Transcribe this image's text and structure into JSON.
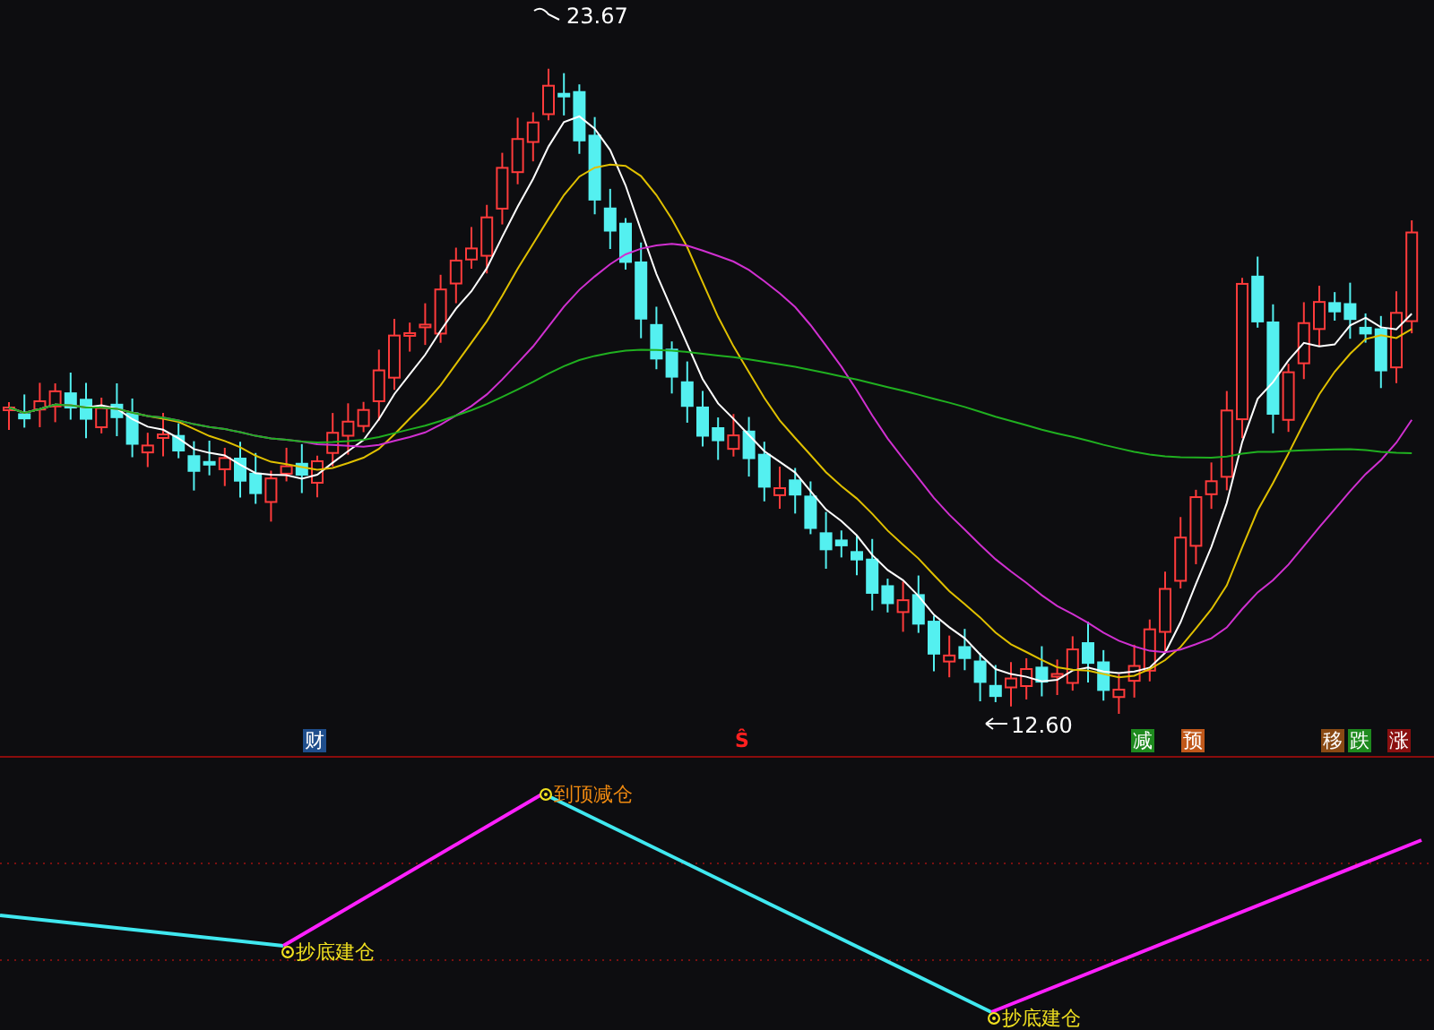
{
  "price_chart": {
    "high_label": "23.67",
    "low_label": "12.60",
    "markers": [
      {
        "text": "财",
        "kind": "badge",
        "color": "#1f4e8c"
      },
      {
        "text": "Ŝ",
        "kind": "plain",
        "color": "#ff2020"
      },
      {
        "text": "减",
        "kind": "badge",
        "color": "#1e8a1e"
      },
      {
        "text": "预",
        "kind": "badge",
        "color": "#c0581a"
      },
      {
        "text": "移",
        "kind": "badge",
        "color": "#8a4a14"
      },
      {
        "text": "跌",
        "kind": "badge",
        "color": "#1e8a1e"
      },
      {
        "text": "涨",
        "kind": "badge",
        "color": "#8a1010"
      }
    ]
  },
  "indicator": {
    "signals": [
      {
        "text": "抄底建仓",
        "kind": "bottom"
      },
      {
        "text": "到顶减仓",
        "kind": "top"
      },
      {
        "text": "抄底建仓",
        "kind": "bottom"
      }
    ]
  }
}
